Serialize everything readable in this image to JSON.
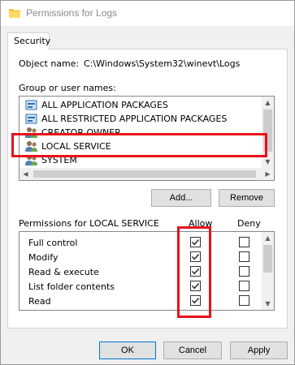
{
  "window": {
    "title": "Permissions for Logs"
  },
  "tabs": [
    {
      "label": "Security",
      "selected": true
    }
  ],
  "object": {
    "label": "Object name:",
    "value": "C:\\Windows\\System32\\winevt\\Logs"
  },
  "groups": {
    "label": "Group or user names:",
    "items": [
      {
        "label": "ALL APPLICATION PACKAGES",
        "icon": "package-group-icon"
      },
      {
        "label": "ALL RESTRICTED APPLICATION PACKAGES",
        "icon": "package-group-icon"
      },
      {
        "label": "CREATOR OWNER",
        "icon": "users-icon"
      },
      {
        "label": "LOCAL SERVICE",
        "icon": "users-icon",
        "highlighted": true
      },
      {
        "label": "SYSTEM",
        "icon": "users-icon"
      }
    ],
    "add_label": "Add...",
    "remove_label": "Remove"
  },
  "permissions": {
    "label": "Permissions for LOCAL SERVICE",
    "allow_header": "Allow",
    "deny_header": "Deny",
    "rows": [
      {
        "name": "Full control",
        "allow": true,
        "deny": false
      },
      {
        "name": "Modify",
        "allow": true,
        "deny": false
      },
      {
        "name": "Read & execute",
        "allow": true,
        "deny": false
      },
      {
        "name": "List folder contents",
        "allow": true,
        "deny": false
      },
      {
        "name": "Read",
        "allow": true,
        "deny": false
      }
    ]
  },
  "footer": {
    "ok_label": "OK",
    "cancel_label": "Cancel",
    "apply_label": "Apply"
  },
  "colors": {
    "highlight_box": "#e8111b",
    "default_button_border": "#0078d7"
  }
}
